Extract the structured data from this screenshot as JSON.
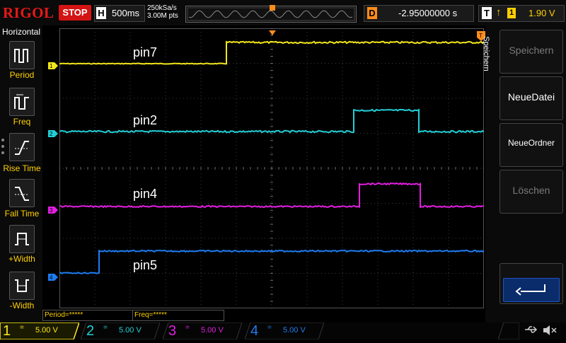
{
  "brand": "RIGOL",
  "run_state": "STOP",
  "timebase": {
    "key": "H",
    "value": "500ms"
  },
  "sample_rate": "250kSa/s",
  "memory_depth": "3.00M pts",
  "delay": {
    "key": "D",
    "value": "-2.95000000 s"
  },
  "trigger": {
    "key": "T",
    "edge": "↑",
    "source": "1",
    "level": "1.90 V"
  },
  "left_menu": {
    "title": "Horizontal",
    "items": [
      {
        "label": "Period"
      },
      {
        "label": "Freq"
      },
      {
        "label": "Rise Time"
      },
      {
        "label": "Fall Time"
      },
      {
        "label": "+Width"
      },
      {
        "label": "-Width"
      }
    ]
  },
  "right_menu": {
    "title": "Speichern",
    "items": [
      {
        "label": "Speichern",
        "state": "disabled"
      },
      {
        "label": "NeueDatei",
        "state": "enabled"
      },
      {
        "label": "NeueOrdner",
        "state": "enabled"
      },
      {
        "label": "Löschen",
        "state": "disabled"
      }
    ]
  },
  "measurements": {
    "period": "Period=*****",
    "freq": "Freq=*****"
  },
  "traces": [
    {
      "id": "1",
      "label": "pin7",
      "color": "#f2e61a"
    },
    {
      "id": "2",
      "label": "pin2",
      "color": "#22cfd6"
    },
    {
      "id": "3",
      "label": "pin4",
      "color": "#e21ee0"
    },
    {
      "id": "4",
      "label": "pin5",
      "color": "#1e7cf0"
    }
  ],
  "channels": [
    {
      "num": "1",
      "coupling": "=",
      "scale": "5.00 V",
      "color": "#ffe81a",
      "active": true
    },
    {
      "num": "2",
      "coupling": "=",
      "scale": "5.00 V",
      "color": "#22cfd6",
      "active": false
    },
    {
      "num": "3",
      "coupling": "=",
      "scale": "5.00 V",
      "color": "#e21ee0",
      "active": false
    },
    {
      "num": "4",
      "coupling": "=",
      "scale": "5.00 V",
      "color": "#1e7cf0",
      "active": false
    }
  ],
  "icons": {
    "usb": "usb-icon",
    "mute": "speaker-mute-icon"
  }
}
